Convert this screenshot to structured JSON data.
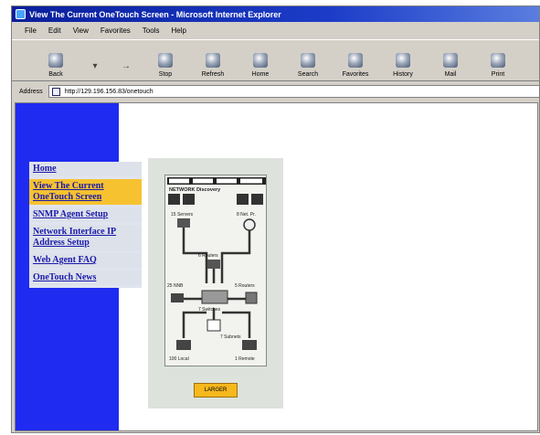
{
  "window": {
    "title": "View The Current OneTouch Screen - Microsoft Internet Explorer"
  },
  "menu": [
    "File",
    "Edit",
    "View",
    "Favorites",
    "Tools",
    "Help"
  ],
  "toolbar": [
    {
      "label": "Back",
      "icon": "back-icon"
    },
    {
      "label": "",
      "icon": "dropdown-arrow-icon"
    },
    {
      "label": "",
      "icon": "forward-icon"
    },
    {
      "label": "Stop",
      "icon": "stop-icon"
    },
    {
      "label": "Refresh",
      "icon": "refresh-icon"
    },
    {
      "label": "Home",
      "icon": "home-icon"
    },
    {
      "label": "Search",
      "icon": "search-icon"
    },
    {
      "label": "Favorites",
      "icon": "favorites-icon"
    },
    {
      "label": "History",
      "icon": "history-icon"
    },
    {
      "label": "Mail",
      "icon": "mail-icon"
    },
    {
      "label": "Print",
      "icon": "print-icon"
    }
  ],
  "address": {
    "label": "Address",
    "url": "http://129.196.156.83/onetouch"
  },
  "nav": [
    {
      "label": "Home",
      "active": false
    },
    {
      "label": "View The Current OneTouch Screen",
      "active": true
    },
    {
      "label": "SNMP Agent Setup",
      "active": false
    },
    {
      "label": "Network Interface IP Address Setup",
      "active": false
    },
    {
      "label": "Web Agent FAQ",
      "active": false
    },
    {
      "label": "OneTouch News",
      "active": false
    }
  ],
  "device_screen": {
    "tab_labels": [
      "",
      "",
      "",
      ""
    ],
    "header": "NETWORK Discovery",
    "nodes": [
      {
        "label": "15 Servers"
      },
      {
        "label": "8 Net. Pr."
      },
      {
        "label": "6 Routers"
      },
      {
        "label": "25 NNB"
      },
      {
        "label": "5 Routers"
      },
      {
        "label": "7 Switches"
      },
      {
        "label": "7 Subnets"
      },
      {
        "label": "100 Local"
      },
      {
        "label": "1 Remote"
      }
    ]
  },
  "larger_button": "LARGER",
  "colors": {
    "title_bar": "#0a1f9c",
    "sidebar_blue": "#1f2bf0",
    "nav_active": "#f6c230",
    "larger_button": "#f6b81c"
  }
}
